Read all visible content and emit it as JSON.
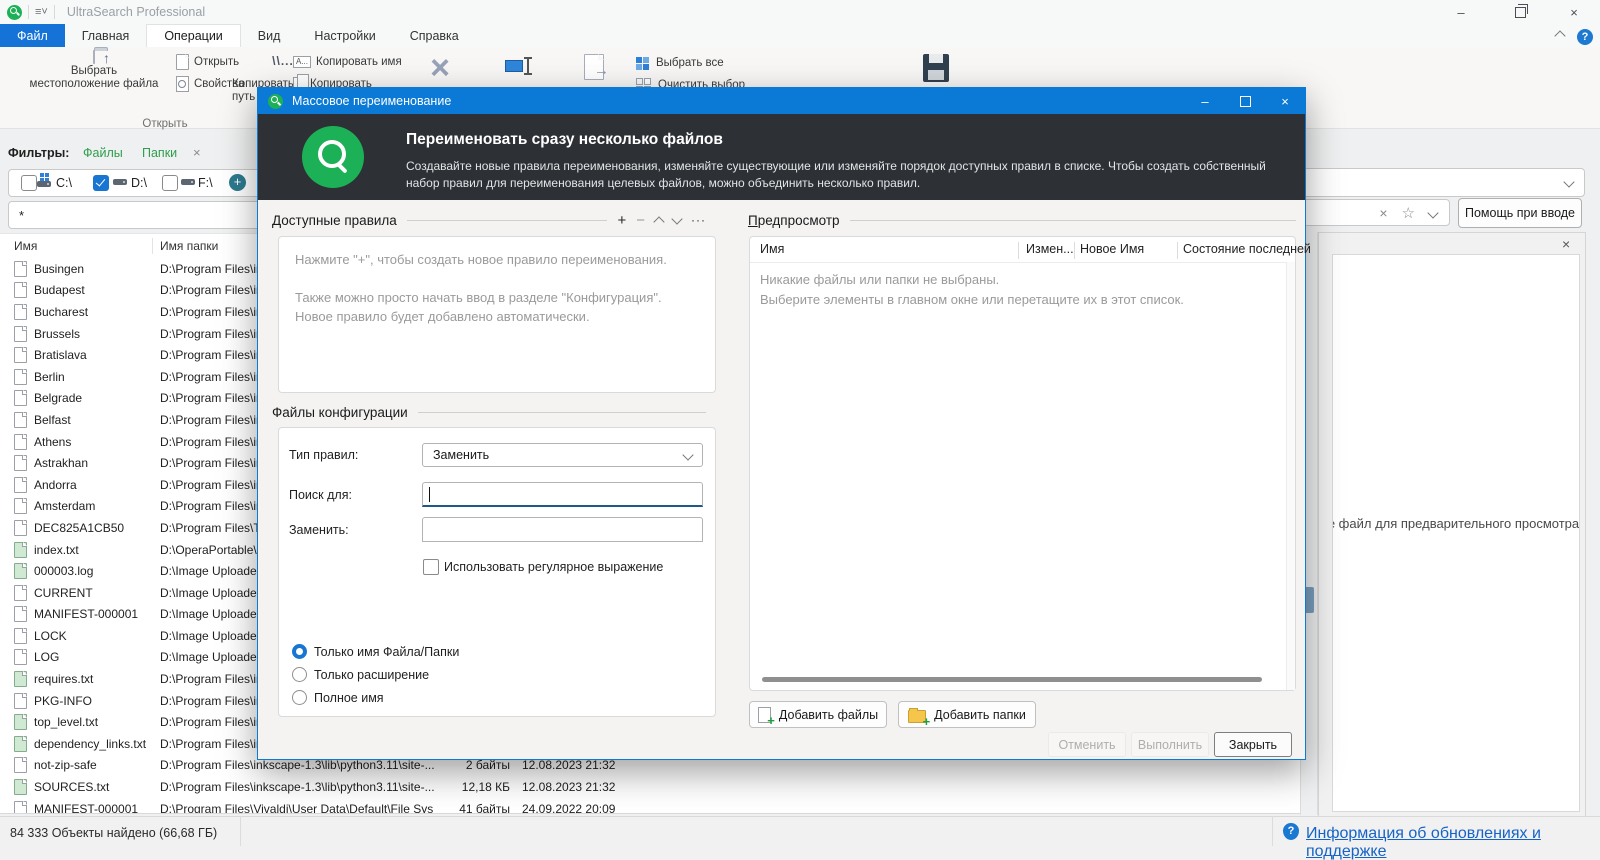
{
  "app": {
    "title": "UltraSearch Professional"
  },
  "tabs": {
    "items": [
      {
        "label": "Файл"
      },
      {
        "label": "Главная"
      },
      {
        "label": "Операции"
      },
      {
        "label": "Вид"
      },
      {
        "label": "Настройки"
      },
      {
        "label": "Справка"
      }
    ]
  },
  "ribbon": {
    "select_location_line1": "Выбрать",
    "select_location_line2": "местоположение файла",
    "open_small": "Открыть",
    "properties": "Свойства",
    "open_group_label": "Открыть",
    "copy_path_line1": "Копировать",
    "copy_path_line2": "путь",
    "copy_name": "Копировать имя",
    "copy": "Копировать",
    "select_all": "Выбрать все",
    "clear_selection": "Очистить выбор"
  },
  "filters": {
    "label": "Фильтры:",
    "files": "Файлы",
    "folders": "Папки"
  },
  "drives": {
    "items": [
      {
        "label": "C:\\",
        "checked": false
      },
      {
        "label": "D:\\",
        "checked": true
      },
      {
        "label": "F:\\",
        "checked": false
      }
    ]
  },
  "search": {
    "value": "*"
  },
  "help_button": "Помощь при вводе",
  "file_list": {
    "columns": {
      "name": "Имя",
      "folder": "Имя папки"
    },
    "rows": [
      {
        "name": "Busingen",
        "icon": "plain",
        "path": "D:\\Program Files\\in"
      },
      {
        "name": "Budapest",
        "icon": "plain",
        "path": "D:\\Program Files\\in"
      },
      {
        "name": "Bucharest",
        "icon": "plain",
        "path": "D:\\Program Files\\in"
      },
      {
        "name": "Brussels",
        "icon": "plain",
        "path": "D:\\Program Files\\in"
      },
      {
        "name": "Bratislava",
        "icon": "plain",
        "path": "D:\\Program Files\\in"
      },
      {
        "name": "Berlin",
        "icon": "plain",
        "path": "D:\\Program Files\\in"
      },
      {
        "name": "Belgrade",
        "icon": "plain",
        "path": "D:\\Program Files\\in"
      },
      {
        "name": "Belfast",
        "icon": "plain",
        "path": "D:\\Program Files\\in"
      },
      {
        "name": "Athens",
        "icon": "plain",
        "path": "D:\\Program Files\\in"
      },
      {
        "name": "Astrakhan",
        "icon": "plain",
        "path": "D:\\Program Files\\in"
      },
      {
        "name": "Andorra",
        "icon": "plain",
        "path": "D:\\Program Files\\in"
      },
      {
        "name": "Amsterdam",
        "icon": "plain",
        "path": "D:\\Program Files\\in"
      },
      {
        "name": "DEC825A1CB50",
        "icon": "plain",
        "path": "D:\\Program Files\\T"
      },
      {
        "name": "index.txt",
        "icon": "text",
        "path": "D:\\OperaPortable\\"
      },
      {
        "name": "000003.log",
        "icon": "text",
        "path": "D:\\Image Uploade"
      },
      {
        "name": "CURRENT",
        "icon": "plain",
        "path": "D:\\Image Uploade"
      },
      {
        "name": "MANIFEST-000001",
        "icon": "plain",
        "path": "D:\\Image Uploade"
      },
      {
        "name": "LOCK",
        "icon": "plain",
        "path": "D:\\Image Uploade"
      },
      {
        "name": "LOG",
        "icon": "plain",
        "path": "D:\\Image Uploade"
      },
      {
        "name": "requires.txt",
        "icon": "text",
        "path": "D:\\Program Files\\in"
      },
      {
        "name": "PKG-INFO",
        "icon": "plain",
        "path": "D:\\Program Files\\in"
      },
      {
        "name": "top_level.txt",
        "icon": "text",
        "path": "D:\\Program Files\\in"
      },
      {
        "name": "dependency_links.txt",
        "icon": "text",
        "path": "D:\\Program Files\\in"
      },
      {
        "name": "not-zip-safe",
        "icon": "plain",
        "path": "D:\\Program Files\\inkscape-1.3\\lib\\python3.11\\site-...",
        "size": "2 байты",
        "date": "12.08.2023 21:32"
      },
      {
        "name": "SOURCES.txt",
        "icon": "text",
        "path": "D:\\Program Files\\inkscape-1.3\\lib\\python3.11\\site-...",
        "size": "12,18 КБ",
        "date": "12.08.2023 21:32"
      },
      {
        "name": "MANIFEST-000001",
        "icon": "plain",
        "path": "D:\\Program Files\\Vivaldi\\User Data\\Default\\File Sys",
        "size": "41 байты",
        "date": "24.09.2022 20:09"
      }
    ]
  },
  "preview_panel": {
    "placeholder": "Выберите файл для предварительного просмотра"
  },
  "statusbar": {
    "left": "84 333 Объекты найдено (66,68 ГБ)",
    "link": "Информация об обновлениях и поддержке"
  },
  "dialog": {
    "title": "Массовое переименование",
    "header": {
      "title": "Переименовать сразу несколько файлов",
      "description": "Создавайте новые правила переименования, изменяйте существующие или изменяйте порядок доступных правил в списке. Чтобы создать собственный набор правил для переименования целевых файлов, можно объединить несколько правил."
    },
    "rules": {
      "title": "Доступные правила",
      "hint1": "Нажмите \"+\", чтобы создать новое правило переименования.",
      "hint2": "Также можно просто начать ввод в разделе \"Конфигурация\". Новое правило будет добавлено автоматически."
    },
    "config": {
      "title": "Файлы конфигурации",
      "rule_type_label": "Тип правил:",
      "rule_type_value": "Заменить",
      "search_label": "Поиск для:",
      "search_value": "",
      "replace_label": "Заменить:",
      "replace_value": "",
      "regex_label": "Использовать регулярное выражение",
      "radio_name_only": "Только имя Файла/Папки",
      "radio_ext_only": "Только расширение",
      "radio_full_name": "Полное имя"
    },
    "preview": {
      "title_first": "П",
      "title_rest": "редпросмотр",
      "columns": [
        "Имя",
        "Измен...",
        "Новое Имя",
        "Состояние последней"
      ],
      "empty1": "Никакие файлы или папки не выбраны.",
      "empty2": "Выберите элементы в главном окне или перетащите их в этот список."
    },
    "buttons": {
      "add_files": "Добавить файлы",
      "add_folders": "Добавить папки",
      "cancel": "Отменить",
      "execute": "Выполнить",
      "close": "Закрыть"
    }
  }
}
